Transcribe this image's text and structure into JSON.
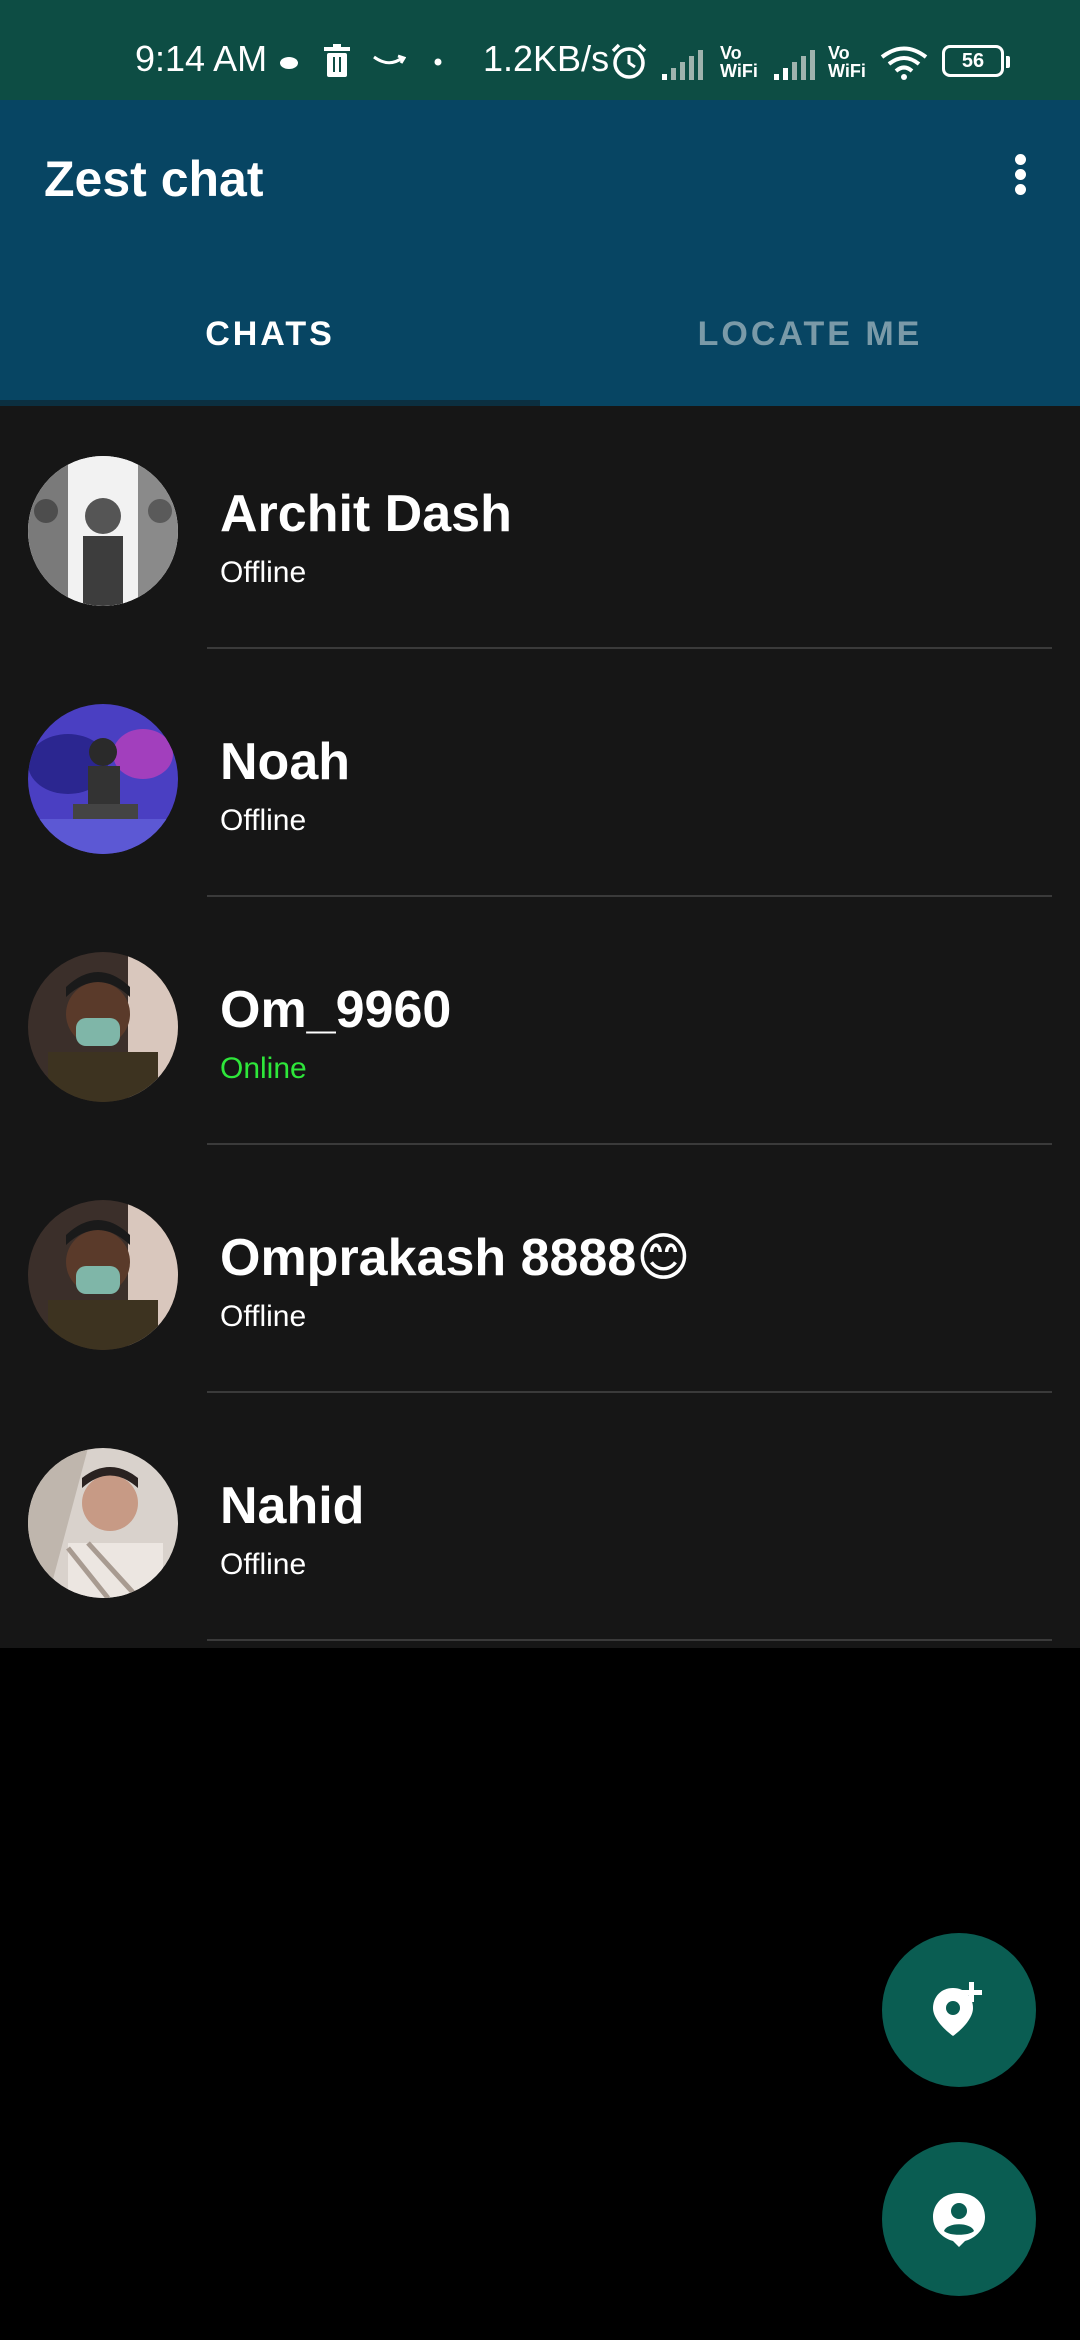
{
  "status_bar": {
    "time": "9:14 AM",
    "net_speed": "1.2KB/s",
    "vowifi_1": "Vo\nWiFi",
    "vowifi_2": "Vo\nWiFi",
    "battery": "56",
    "icons": [
      "cloud-icon",
      "delete-icon",
      "amazon-icon",
      "dot-icon",
      "alarm-icon",
      "signal-icon",
      "signal-icon",
      "wifi-icon",
      "battery-icon"
    ]
  },
  "app_bar": {
    "title": "Zest chat",
    "menu_icon": "more-vert-icon"
  },
  "tabs": [
    {
      "label": "CHATS",
      "selected": true
    },
    {
      "label": "LOCATE ME",
      "selected": false
    }
  ],
  "chats": [
    {
      "name": "Archit Dash",
      "status": "Offline"
    },
    {
      "name": "Noah",
      "status": "Offline"
    },
    {
      "name": "Om_9960",
      "status": "Online"
    },
    {
      "name": "Omprakash 8888😊",
      "status": "Offline"
    },
    {
      "name": "Nahid",
      "status": "Offline"
    }
  ],
  "fabs": [
    {
      "icon": "add-location-icon"
    },
    {
      "icon": "account-pin-icon"
    }
  ],
  "colors": {
    "status_bar": "#0d4d44",
    "app_bar": "#074563",
    "list_bg": "#161616",
    "online": "#2ee63a",
    "fab": "#0a5d52"
  }
}
